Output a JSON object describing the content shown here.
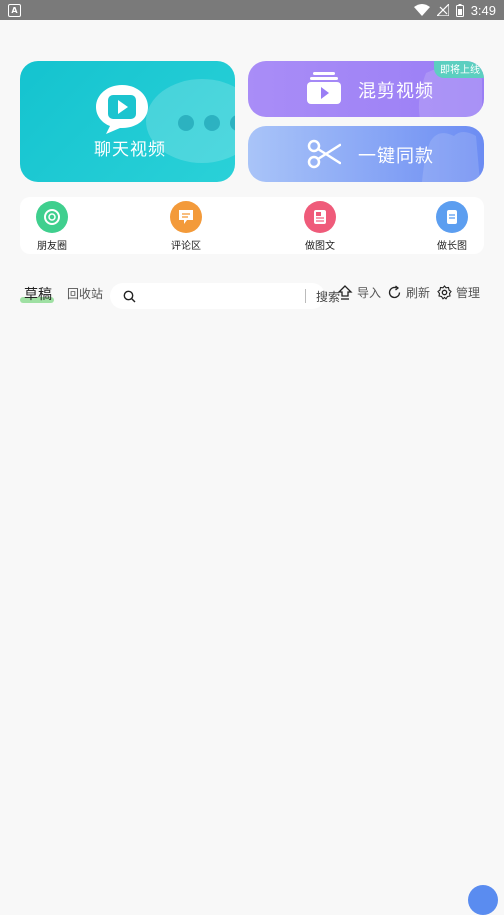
{
  "status_bar": {
    "time": "3:49",
    "app_icon_letter": "A"
  },
  "cards": {
    "chat_video": {
      "label": "聊天视频"
    },
    "mix_video": {
      "label": "混剪视频",
      "badge": "即将上线"
    },
    "one_click": {
      "label": "一键同款"
    }
  },
  "tools": [
    {
      "label": "朋友圈",
      "color": "#3fcf8e"
    },
    {
      "label": "评论区",
      "color": "#f39a3a"
    },
    {
      "label": "做图文",
      "color": "#ef5b7a"
    },
    {
      "label": "做长图",
      "color": "#5c9ef0"
    }
  ],
  "tabs": {
    "draft": "草稿",
    "recycle": "回收站"
  },
  "search": {
    "placeholder": "",
    "button": "搜索"
  },
  "actions": {
    "import": "导入",
    "refresh": "刷新",
    "manage": "管理"
  }
}
